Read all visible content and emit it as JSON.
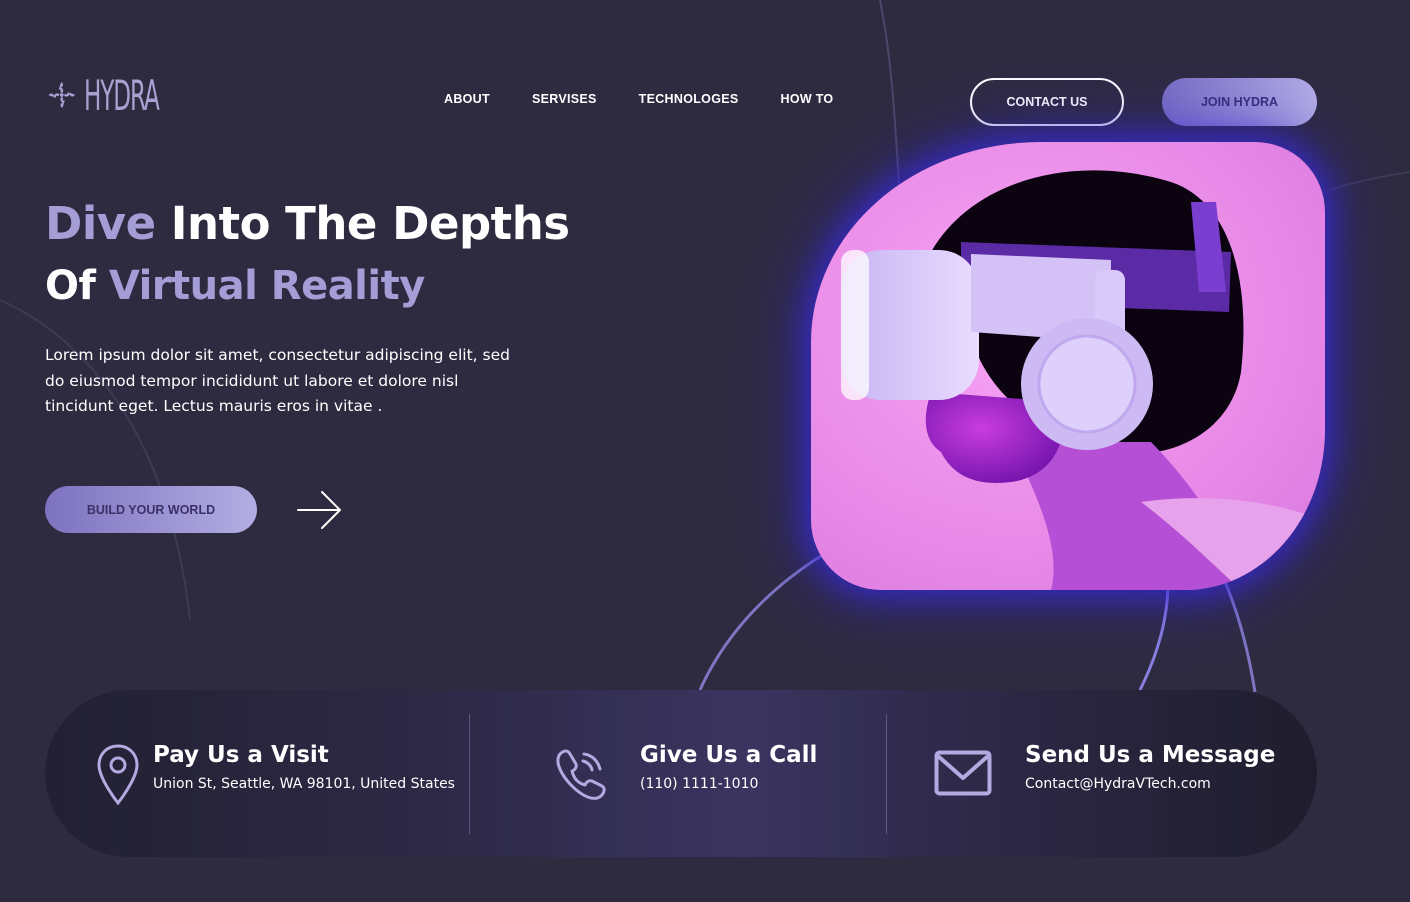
{
  "brand": {
    "name": "HYDRA"
  },
  "nav": {
    "items": [
      {
        "label": "ABOUT"
      },
      {
        "label": "SERVISES"
      },
      {
        "label": "TECHNOLOGES"
      },
      {
        "label": "HOW TO"
      }
    ]
  },
  "header": {
    "contact_label": "CONTACT US",
    "join_label": "JOIN HYDRA"
  },
  "hero": {
    "title_accent_1": "Dive",
    "title_rest_1": " Into The Depths",
    "title_start_2": "Of ",
    "title_accent_2": "Virtual Reality",
    "description": "Lorem ipsum dolor sit amet, consectetur adipiscing elit, sed do eiusmod tempor incididunt ut labore et dolore nisl tincidunt eget. Lectus mauris eros in vitae .",
    "cta_label": "BUILD YOUR WORLD"
  },
  "contact": {
    "visit": {
      "title": "Pay Us a Visit",
      "detail": "Union St, Seattle, WA 98101, United States"
    },
    "call": {
      "title": "Give Us a Call",
      "detail": "(110) 1111-1010"
    },
    "message": {
      "title": "Send Us a Message",
      "detail": "Contact@HydraVTech.com"
    }
  },
  "colors": {
    "background": "#2e2b40",
    "accent": "#a49dd6",
    "button_gradient_start": "#7a6fc4",
    "button_gradient_end": "#b4aee6",
    "image_glow": "#3728dc"
  },
  "icons": [
    "hydra-logo-icon",
    "arrow-right-icon",
    "location-pin-icon",
    "phone-icon",
    "mail-icon"
  ]
}
